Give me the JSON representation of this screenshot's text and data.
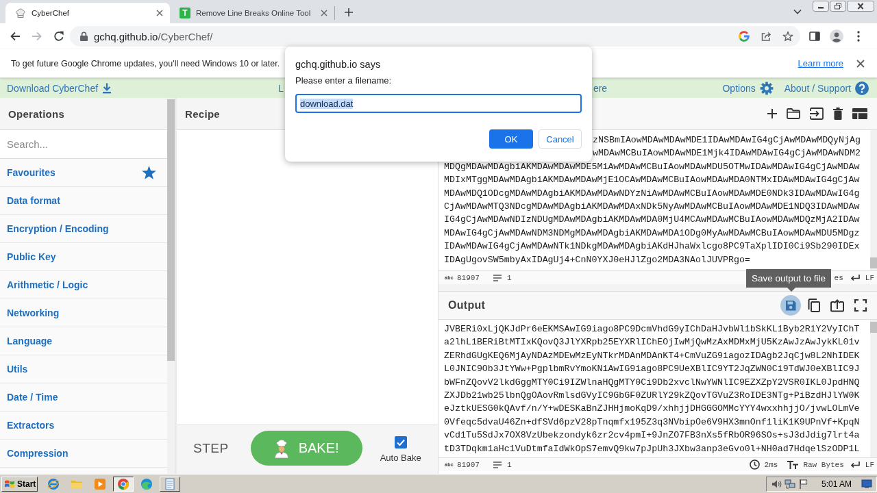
{
  "browser": {
    "tabs": [
      {
        "title": "CyberChef",
        "selected": true,
        "kind": "hat"
      },
      {
        "title": "Remove Line Breaks Online Tool",
        "selected": false,
        "kind": "letter",
        "icon_text": "T"
      }
    ],
    "nav": [
      {
        "kind": "back",
        "disabled": false
      },
      {
        "kind": "forward",
        "disabled": true
      },
      {
        "kind": "reload",
        "disabled": false
      }
    ],
    "address": {
      "host": "gchq.github.io",
      "path": "/CyberChef/"
    }
  },
  "infobar": {
    "message": "To get future Google Chrome updates, you'll need Windows 10 or later.",
    "link": "Learn more"
  },
  "header": {
    "download": "Download CyberChef",
    "partly_hidden_texts": [
      "L",
      "ere"
    ],
    "links": [
      {
        "label": "Options",
        "kind": "options"
      },
      {
        "label": "About / Support",
        "kind": "help"
      }
    ]
  },
  "operations": {
    "title": "Operations",
    "search_placeholder": "Search...",
    "categories": [
      {
        "label": "Favourites",
        "kind": "favourites"
      },
      {
        "label": "Data format",
        "kind": "category"
      },
      {
        "label": "Encryption / Encoding",
        "kind": "category"
      },
      {
        "label": "Public Key",
        "kind": "category"
      },
      {
        "label": "Arithmetic / Logic",
        "kind": "category"
      },
      {
        "label": "Networking",
        "kind": "category"
      },
      {
        "label": "Language",
        "kind": "category"
      },
      {
        "label": "Utils",
        "kind": "category"
      },
      {
        "label": "Date / Time",
        "kind": "category"
      },
      {
        "label": "Extractors",
        "kind": "category"
      },
      {
        "label": "Compression",
        "kind": "category"
      }
    ]
  },
  "recipe": {
    "title": "Recipe",
    "step": "STEP",
    "bake": "BAKE!",
    "auto_bake": {
      "label": "Auto Bake",
      "checked": true
    }
  },
  "input": {
    "covered_lines": [
      "zNSBmIAowMDAwMDAwMDE1IDAwMDAwIG4gCjAwMDAwMDQyNjAg",
      "wMDAwMCBuIAowMDAwMDE1Mjk4IDAwMDAwIG4gCjAwMDAwNDM2"
    ],
    "lines": [
      "MDQgMDAwMDAgbiAKMDAwMDAwMDE5MiAwMDAwMCBuIAowMDAwMDU5OTMwIDAwMDAwIG4gCjAwMDAw",
      "MDIxMTggMDAwMDAgbiAKMDAwMDAwMjE1OCAwMDAwMCBuIAowMDAwMDA0NTMxIDAwMDAwIG4gCjAw",
      "MDAwMDQ1ODcgMDAwMDAgbiAKMDAwMDAwNDYzNiAwMDAwMCBuIAowMDAwMDE0NDk3IDAwMDAwIG4g",
      "CjAwMDAwMTQ3NDcgMDAwMDAgbiAKMDAwMDAxNDk5NyAwMDAwMCBuIAowMDAwMDE1NDQ3IDAwMDAw",
      "IG4gCjAwMDAwNDIzNDUgMDAwMDAgbiAKMDAwMDA0MjU4MCAwMDAwMCBuIAowMDAwMDQzMjA2IDAw",
      "MDAwIG4gCjAwMDAwNDM3NDMgMDAwMDAgbiAKMDAwMDA1ODg0MyAwMDAwMCBuIAowMDAwMDU5MDgz",
      "IDAwMDAwIG4gCjAwMDAwNTk1NDkgMDAwMDAgbiAKdHJhaWxlcgo8PC9TaXplIDI0Ci9Sb290IDEx",
      "IDAgUgovSW5mbyAxIDAgUj4+CnN0YXJ0eHJlZgo2MDA3NAolJUVPRgo="
    ],
    "status": {
      "length_icon": "abc",
      "length": "81907",
      "lines": "1",
      "partly_hidden_text": "es",
      "eol": "LF"
    }
  },
  "output": {
    "title": "Output",
    "buttons": [
      {
        "kind": "save",
        "hovered": true
      },
      {
        "kind": "copy",
        "hovered": false
      },
      {
        "kind": "to-input",
        "hovered": false
      },
      {
        "kind": "maximise",
        "hovered": false
      }
    ],
    "tooltip": "Save output to file",
    "lines": [
      "JVBERi0xLjQKJdPr6eEKMSAwIG9iago8PC9DcmVhdG9yIChDaHJvbWl1bSkKL1Byb2R1Y2VyIChT",
      "a2lhL1BERiBtMTIxKQovQ3JlYXRpb25EYXRlIChEOjIwMjQwMzAxMDMxMjU5KzAwJzAwJykKL01v",
      "ZERhdGUgKEQ6MjAyNDAzMDEwMzEyNTkrMDAnMDAnKT4+CmVuZG9iagozIDAgb2JqCjw8L2NhIDEK",
      "L0JNIC9Ob3JtYWw+PgplbmRvYmoKNiAwIG9iago8PC9UeXBlIC9YT2JqZWN0Ci9TdWJ0eXBlIC9J",
      "bWFnZQovV2lkdGggMTY0Ci9IZWlnaHQgMTY0Ci9Db2xvclNwYWNlIC9EZXZpY2VSR0IKL0JpdHNQ",
      "ZXJDb21wb25lbnQgOAovRmlsdGVyIC9GbGF0ZURlY29kZQovTGVuZ3RoIDE3NTg+PiBzdHJlYW0K",
      "eJztkUESG0kQAvf/n/Y+wDESKaBnZJHHjmoKqD9/xhhjjDHGGGOMMcYYY4wxxhhjjO/jvwLOLmVe",
      "0Vfeqc5dvaU46Zn+dfSVd6pzV28pTnqmfx195Z3q3NVbipOe6V9HX3mnOnf1liK1K9UPnVf+KpqN",
      "vCd1Tu5SdJx7OX8VzUbekzondyk6zr2cv4pmI+9JnZO7FB3nXs5fRbOR96SOs+sJ3dJdig7lrt4a",
      "tD3TDqkm1aHc1VuDtmfaIdWkOpS7emvQ9kw7pJpUh3JXbw3anp3eGvo0l+NH0ad7HdqelSzODP1L"
    ],
    "status": {
      "length_icon": "abc",
      "length": "81907",
      "lines": "1",
      "time": "2ms",
      "encoding": "Raw Bytes",
      "eol": "LF"
    }
  },
  "dialog": {
    "title": "gchq.github.io says",
    "prompt": "Please enter a filename:",
    "value": "download.dat",
    "value_selected": true,
    "buttons": [
      {
        "label": "OK",
        "kind": "primary"
      },
      {
        "label": "Cancel",
        "kind": "secondary"
      }
    ]
  },
  "taskbar": {
    "start": "Start",
    "apps": [
      {
        "kind": "e-browser",
        "open": false,
        "selected": false
      },
      {
        "kind": "folder",
        "open": false,
        "selected": false
      },
      {
        "kind": "media",
        "open": false,
        "selected": false
      },
      {
        "kind": "ring-browser",
        "open": true,
        "selected": true
      },
      {
        "kind": "wave-browser",
        "open": false,
        "selected": false
      },
      {
        "kind": "notepad",
        "open": true,
        "selected": false
      }
    ],
    "clock": "5:01 AM"
  }
}
